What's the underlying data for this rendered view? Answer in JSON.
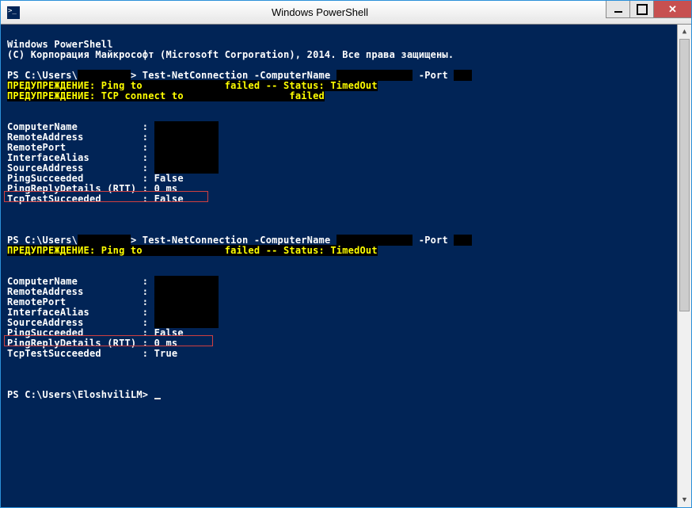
{
  "window": {
    "title": "Windows PowerShell"
  },
  "header": {
    "l1": "Windows PowerShell",
    "l2": "(C) Корпорация Майкрософт (Microsoft Corporation), 2014. Все права защищены."
  },
  "run1": {
    "prompt_a": "PS C:\\Users\\",
    "prompt_b": "> Test-NetConnection -ComputerName ",
    "prompt_c": "-Port ",
    "warn1a": "ПРЕДУПРЕЖДЕНИЕ: Ping to ",
    "warn1b": " failed -- Status: TimedOut",
    "warn2a": "ПРЕДУПРЕЖДЕНИЕ: TCP connect to ",
    "warn2b": " failed",
    "props": {
      "cn": "ComputerName           : ",
      "ra": "RemoteAddress          : ",
      "rp": "RemotePort             : ",
      "ia": "InterfaceAlias         : ",
      "sa": "SourceAddress          : ",
      "ps": "PingSucceeded          : False",
      "pr": "PingReplyDetails (RTT) : 0 ms",
      "tt": "TcpTestSucceeded       : False"
    }
  },
  "run2": {
    "prompt_a": "PS C:\\Users\\",
    "prompt_b": "> Test-NetConnection -ComputerName ",
    "prompt_c": "-Port ",
    "warn1a": "ПРЕДУПРЕЖДЕНИЕ: Ping to ",
    "warn1b": " failed -- Status: TimedOut",
    "props": {
      "cn": "ComputerName           : ",
      "ra": "RemoteAddress          : ",
      "rp": "RemotePort             : ",
      "ia": "InterfaceAlias         : ",
      "sa": "SourceAddress          : ",
      "ps": "PingSucceeded          : False",
      "pr": "PingReplyDetails (RTT) : 0 ms",
      "tt": "TcpTestSucceeded       : True"
    }
  },
  "final_prompt": "PS C:\\Users\\EloshviliLM> "
}
